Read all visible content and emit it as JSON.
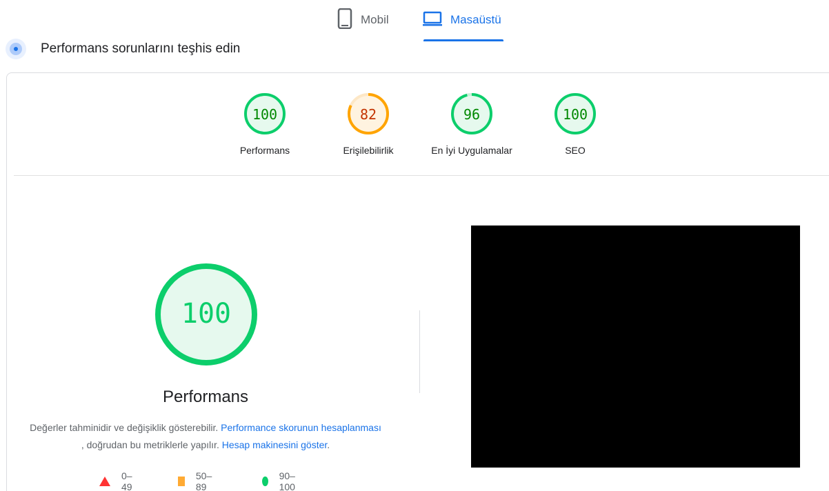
{
  "tabs": {
    "mobile_label": "Mobil",
    "desktop_label": "Masaüstü",
    "selected": "desktop"
  },
  "header": {
    "title": "Performans sorunlarını teşhis edin"
  },
  "summary_scores": [
    {
      "label": "Performans",
      "score": "100",
      "status": "pass"
    },
    {
      "label": "Erişilebilirlik",
      "score": "82",
      "status": "average"
    },
    {
      "label": "En İyi Uygulamalar",
      "score": "96",
      "status": "pass"
    },
    {
      "label": "SEO",
      "score": "100",
      "status": "pass"
    }
  ],
  "performance": {
    "score": "100",
    "title": "Performans",
    "desc_prefix": "Değerler tahminidir ve değişiklik gösterebilir. ",
    "desc_link1": "Performance skorunun hesaplanması",
    "desc_middle": " , doğrudan bu metriklerle yapılır. ",
    "desc_link2": "Hesap makinesini göster",
    "desc_suffix": "."
  },
  "legend": {
    "fail": "0–49",
    "average": "50–89",
    "pass": "90–100"
  },
  "colors": {
    "accent": "#1a73e8",
    "pass": "#0cce6b",
    "pass_text": "#008800",
    "average": "#ffa400",
    "average_text": "#c33300",
    "fail": "#ff3333"
  }
}
